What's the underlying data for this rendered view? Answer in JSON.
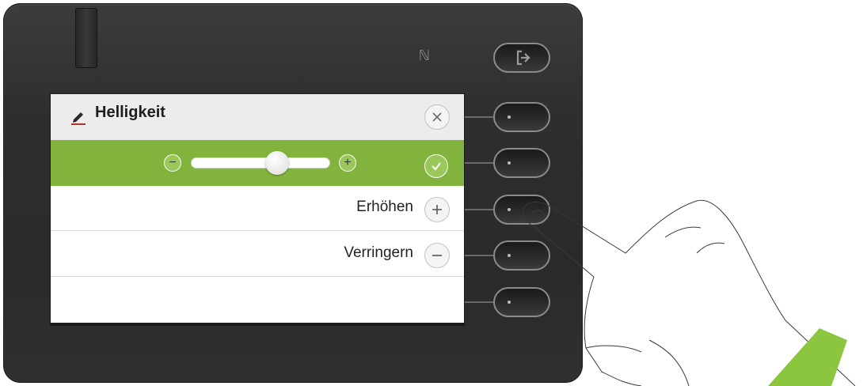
{
  "dialog": {
    "title": "Helligkeit",
    "edit_icon": "pencil-icon",
    "close_icon": "close-icon"
  },
  "slider": {
    "level": 0.62,
    "minus_symbol": "−",
    "plus_symbol": "+",
    "confirm_icon": "checkmark-icon"
  },
  "menu": [
    {
      "label": "Erhöhen",
      "icon": "plus-icon"
    },
    {
      "label": "Verringern",
      "icon": "minus-icon"
    }
  ],
  "hardware": {
    "top_key_icon": "logout-icon",
    "nfc_icon": "nfc-icon",
    "nfc_symbol": "ℕ"
  },
  "colors": {
    "accent_green": "#82b43d",
    "header_gray": "#ececec",
    "phone_body": "#2e2e2e",
    "edit_icon_red": "#b2332c"
  }
}
